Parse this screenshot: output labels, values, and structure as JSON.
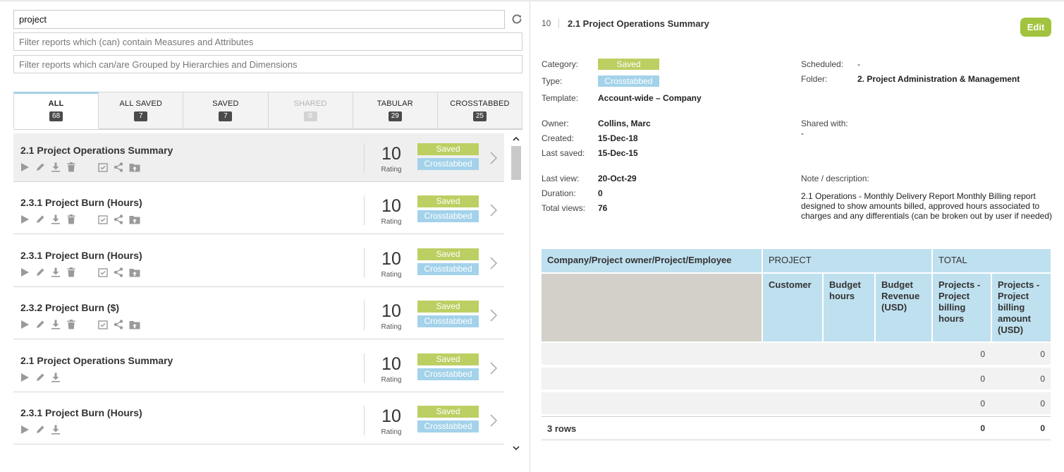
{
  "search": {
    "value": "project"
  },
  "filters": [
    {
      "placeholder": "Filter reports which (can) contain Measures and Attributes"
    },
    {
      "placeholder": "Filter reports which can/are Grouped by Hierarchies and Dimensions"
    }
  ],
  "tabs": [
    {
      "label": "ALL",
      "count": "68",
      "active": true
    },
    {
      "label": "ALL SAVED",
      "count": "7"
    },
    {
      "label": "SAVED",
      "count": "7"
    },
    {
      "label": "SHARED",
      "count": "0",
      "disabled": true
    },
    {
      "label": "TABULAR",
      "count": "29"
    },
    {
      "label": "CROSSTABBED",
      "count": "25"
    }
  ],
  "reports": [
    {
      "title": "2.1 Project Operations Summary",
      "rating": "10",
      "rating_label": "Rating",
      "status": "Saved",
      "type": "Crosstabbed",
      "full_actions": true,
      "selected": true
    },
    {
      "title": "2.3.1 Project Burn (Hours)",
      "rating": "10",
      "rating_label": "Rating",
      "status": "Saved",
      "type": "Crosstabbed",
      "full_actions": true
    },
    {
      "title": "2.3.1 Project Burn (Hours)",
      "rating": "10",
      "rating_label": "Rating",
      "status": "Saved",
      "type": "Crosstabbed",
      "full_actions": true
    },
    {
      "title": "2.3.2 Project Burn ($)",
      "rating": "10",
      "rating_label": "Rating",
      "status": "Saved",
      "type": "Crosstabbed",
      "full_actions": true
    },
    {
      "title": "2.1 Project Operations Summary",
      "rating": "10",
      "rating_label": "Rating",
      "status": "Saved",
      "type": "Crosstabbed",
      "full_actions": false
    },
    {
      "title": "2.3.1 Project Burn (Hours)",
      "rating": "10",
      "rating_label": "Rating",
      "status": "Saved",
      "type": "Crosstabbed",
      "full_actions": false
    }
  ],
  "detail": {
    "id": "10",
    "title": "2.1 Project Operations Summary",
    "edit_label": "Edit",
    "labels": {
      "category": "Category:",
      "type": "Type:",
      "template": "Template:",
      "owner": "Owner:",
      "created": "Created:",
      "last_saved": "Last saved:",
      "last_view": "Last view:",
      "duration": "Duration:",
      "total_views": "Total views:",
      "scheduled": "Scheduled:",
      "folder": "Folder:",
      "shared_with": "Shared with:",
      "note": "Note / description:"
    },
    "category": "Saved",
    "type": "Crosstabbed",
    "template": "Account-wide – Company",
    "owner": "Collins, Marc",
    "created": "15-Dec-18",
    "last_saved": "15-Dec-15",
    "last_view": "20-Oct-29",
    "duration": "0",
    "total_views": "76",
    "scheduled": "-",
    "folder": "2. Project Administration & Management",
    "shared_with": "-",
    "note": "2.1 Operations - Monthly Delivery Report Monthly Billing report designed to show amounts billed, approved hours associated to charges and any differentials (can be broken out by user if needed)"
  },
  "table": {
    "row_header": "Company/Project owner/Project/Employee",
    "group_project": "PROJECT",
    "group_total": "TOTAL",
    "columns": [
      "Customer",
      "Budget hours",
      "Budget Revenue (USD)",
      "Projects - Project billing hours",
      "Projects - Project billing amount (USD)"
    ],
    "rows": [
      [
        "0",
        "0"
      ],
      [
        "0",
        "0"
      ],
      [
        "0",
        "0"
      ]
    ],
    "footer_label": "3 rows",
    "footer_values": [
      "0",
      "0"
    ]
  },
  "colors": {
    "saved": "#bccf62",
    "crosstabbed": "#a3d2ea",
    "edit": "#a1c33d",
    "header": "#bfe0ef"
  }
}
